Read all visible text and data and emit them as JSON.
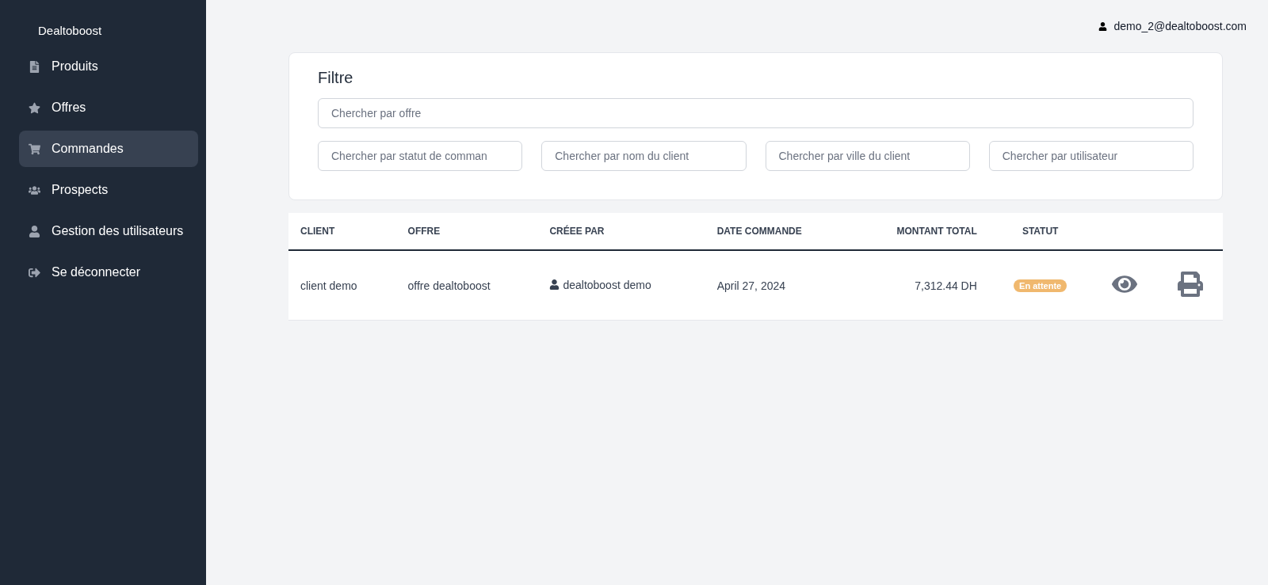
{
  "sidebar": {
    "brand": "Dealtoboost",
    "items": [
      {
        "label": "Produits",
        "selected": false
      },
      {
        "label": "Offres",
        "selected": false
      },
      {
        "label": "Commandes",
        "selected": true
      },
      {
        "label": "Prospects",
        "selected": false
      },
      {
        "label": "Gestion des utilisateurs",
        "selected": false
      },
      {
        "label": "Se déconnecter",
        "selected": false
      }
    ]
  },
  "header": {
    "user_email": "demo_2@dealtoboost.com"
  },
  "filter": {
    "title": "Filtre",
    "main_search": {
      "placeholder": "Chercher par offre"
    },
    "fields": [
      {
        "placeholder": "Chercher par statut de comman"
      },
      {
        "placeholder": "Chercher par nom du client"
      },
      {
        "placeholder": "Chercher par ville du client"
      },
      {
        "placeholder": "Chercher par utilisateur"
      }
    ]
  },
  "table": {
    "columns": [
      "CLIENT",
      "OFFRE",
      "CRÉEE PAR",
      "DATE COMMANDE",
      "MONTANT TOTAL",
      "STATUT"
    ],
    "rows": [
      {
        "client": "client demo",
        "offre": "offre dealtoboost",
        "created_by": "dealtoboost demo",
        "date": "April 27, 2024",
        "total": "7,312.44 DH",
        "status": {
          "label": "En attente",
          "kind": "pending"
        }
      }
    ]
  }
}
